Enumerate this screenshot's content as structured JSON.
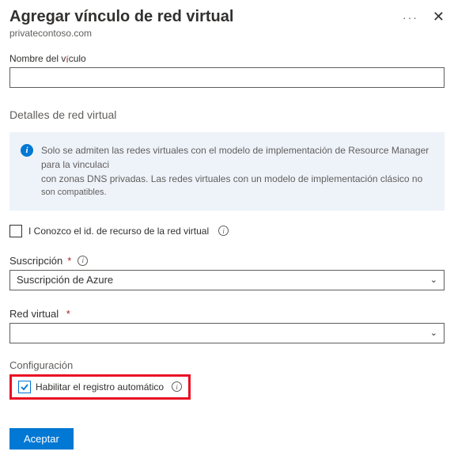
{
  "header": {
    "title": "Agregar vínculo de red virtual",
    "subtitle": "privatecontoso.com"
  },
  "linkName": {
    "label_pre": "Nombre del v",
    "label_post": "culo",
    "value": ""
  },
  "vnetDetails": {
    "heading": "Detalles de red virtual",
    "info_line1": "Solo se admiten las redes virtuales con el modelo de implementación de Resource Manager para la vinculaci",
    "info_line2": "con zonas DNS privadas. Las redes virtuales con un modelo de implementación clásico no",
    "info_line3": "son compatibles."
  },
  "knowResourceId": {
    "label": "I Conozco el id. de recurso de la red virtual",
    "checked": false
  },
  "subscription": {
    "label": "Suscripción",
    "value": "Suscripción de Azure"
  },
  "vnet": {
    "label": "Red virtual",
    "value": ""
  },
  "config": {
    "heading": "Configuración",
    "autoReg": {
      "label": "Habilitar el registro automático",
      "checked": true
    }
  },
  "buttons": {
    "accept": "Aceptar"
  }
}
